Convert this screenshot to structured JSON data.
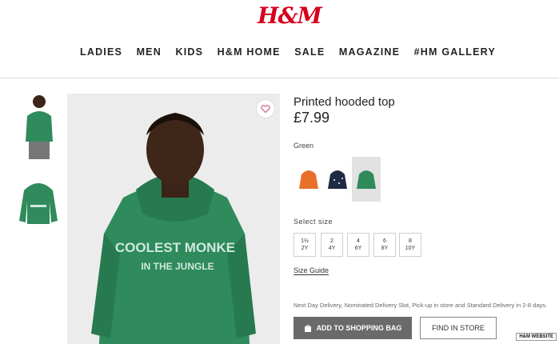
{
  "header": {
    "logo": "H&M",
    "nav": [
      "LADIES",
      "MEN",
      "KIDS",
      "H&M HOME",
      "SALE",
      "MAGAZINE",
      "#HM GALLERY"
    ]
  },
  "product": {
    "title": "Printed hooded top",
    "price": "£7.99",
    "hoodie_print_line1": "COOLEST MONKE",
    "hoodie_print_line2": "IN THE JUNGLE",
    "color_label": "Green",
    "swatches": [
      {
        "name": "orange",
        "color": "#e8702a"
      },
      {
        "name": "navy",
        "color": "#1f2a44"
      },
      {
        "name": "green",
        "color": "#2f8a5c"
      }
    ],
    "size_label": "Select size",
    "sizes": [
      [
        "1½",
        "2Y"
      ],
      [
        "2",
        "4Y"
      ],
      [
        "4",
        "6Y"
      ],
      [
        "6",
        "8Y"
      ],
      [
        "8",
        "10Y"
      ]
    ],
    "size_guide": "Size Guide",
    "delivery_text": "Next Day Delivery, Nominated Delivery Slot, Pick-up in store and Standard Delivery in 2-8 days.",
    "add_to_bag": "ADD TO SHOPPING BAG",
    "find_in_store": "FIND IN STORE"
  },
  "watermark": "H&M WEBSITE",
  "colors": {
    "brand": "#d6001c",
    "hoodie_green": "#2f8a5c",
    "button_gray": "#6a6a6a"
  }
}
